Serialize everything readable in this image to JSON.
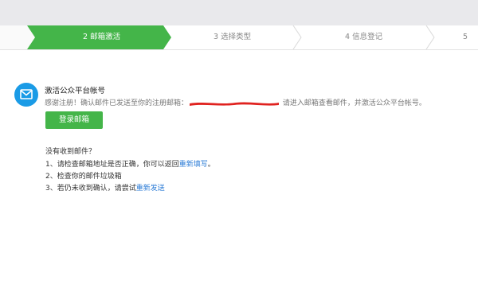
{
  "steps": [
    {
      "label": "2 邮箱激活",
      "active": true
    },
    {
      "label": "3 选择类型",
      "active": false
    },
    {
      "label": "4 信息登记",
      "active": false
    },
    {
      "label": "5",
      "active": false
    }
  ],
  "colors": {
    "accent": "#44b549",
    "link": "#2b7bd6",
    "icon": "#1a9be6"
  },
  "activation": {
    "title": "激活公众平台帐号",
    "desc_before": "感谢注册！确认邮件已发送至你的注册邮箱：",
    "desc_after": "请进入邮箱查看邮件，并激活公众平台帐号。",
    "login_button": "登录邮箱"
  },
  "help": {
    "heading": "没有收到邮件？",
    "item1_text": "1、请检查邮箱地址是否正确，你可以返回",
    "item1_link": "重新填写",
    "item1_end": "。",
    "item2_text": "2、检查你的邮件垃圾箱",
    "item3_text": "3、若仍未收到确认，请尝试",
    "item3_link": "重新发送"
  }
}
